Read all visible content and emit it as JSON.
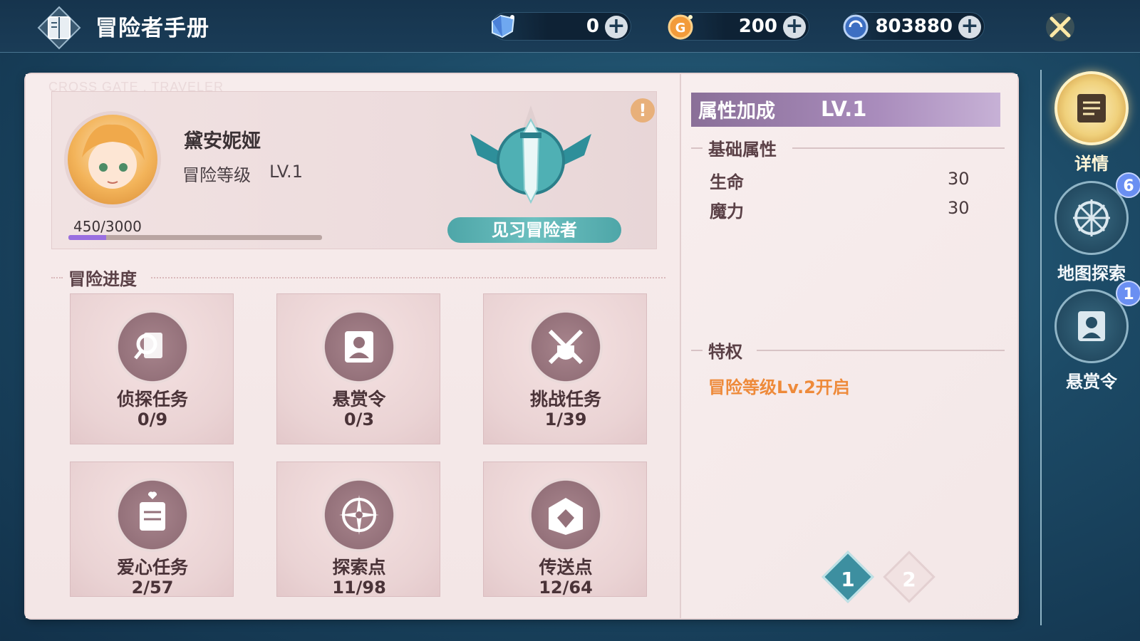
{
  "header": {
    "title": "冒险者手册",
    "currencies": [
      {
        "name": "crystal",
        "value": "0"
      },
      {
        "name": "gold",
        "value": "200"
      },
      {
        "name": "silver",
        "value": "803880"
      }
    ]
  },
  "watermark": "CROSS GATE . TRAVELER",
  "profile": {
    "name": "黛安妮娅",
    "level_label": "冒险等级",
    "level_value": "LV.1",
    "exp_text": "450/3000",
    "exp_fraction": 0.15,
    "rank": "见习冒险者"
  },
  "progress": {
    "title": "冒险进度",
    "tiles": [
      {
        "label": "侦探任务",
        "count": "0/9"
      },
      {
        "label": "悬赏令",
        "count": "0/3"
      },
      {
        "label": "挑战任务",
        "count": "1/39"
      },
      {
        "label": "爱心任务",
        "count": "2/57"
      },
      {
        "label": "探索点",
        "count": "11/98"
      },
      {
        "label": "传送点",
        "count": "12/64"
      }
    ]
  },
  "attributes": {
    "title": "属性加成",
    "level": "LV.1",
    "basic_title": "基础属性",
    "stats": [
      {
        "name": "生命",
        "value": "30"
      },
      {
        "name": "魔力",
        "value": "30"
      }
    ],
    "privilege_title": "特权",
    "privilege_text": "冒险等级Lv.2开启"
  },
  "pagination": {
    "pages": [
      "1",
      "2"
    ],
    "current": "1"
  },
  "side_nav": [
    {
      "label": "详情",
      "badge": ""
    },
    {
      "label": "地图探索",
      "badge": "6"
    },
    {
      "label": "悬赏令",
      "badge": "1"
    }
  ],
  "colors": {
    "accent_teal": "#3d8fa0",
    "privilege_orange": "#ee8a3a",
    "exp_purple": "#9a6fe0"
  }
}
